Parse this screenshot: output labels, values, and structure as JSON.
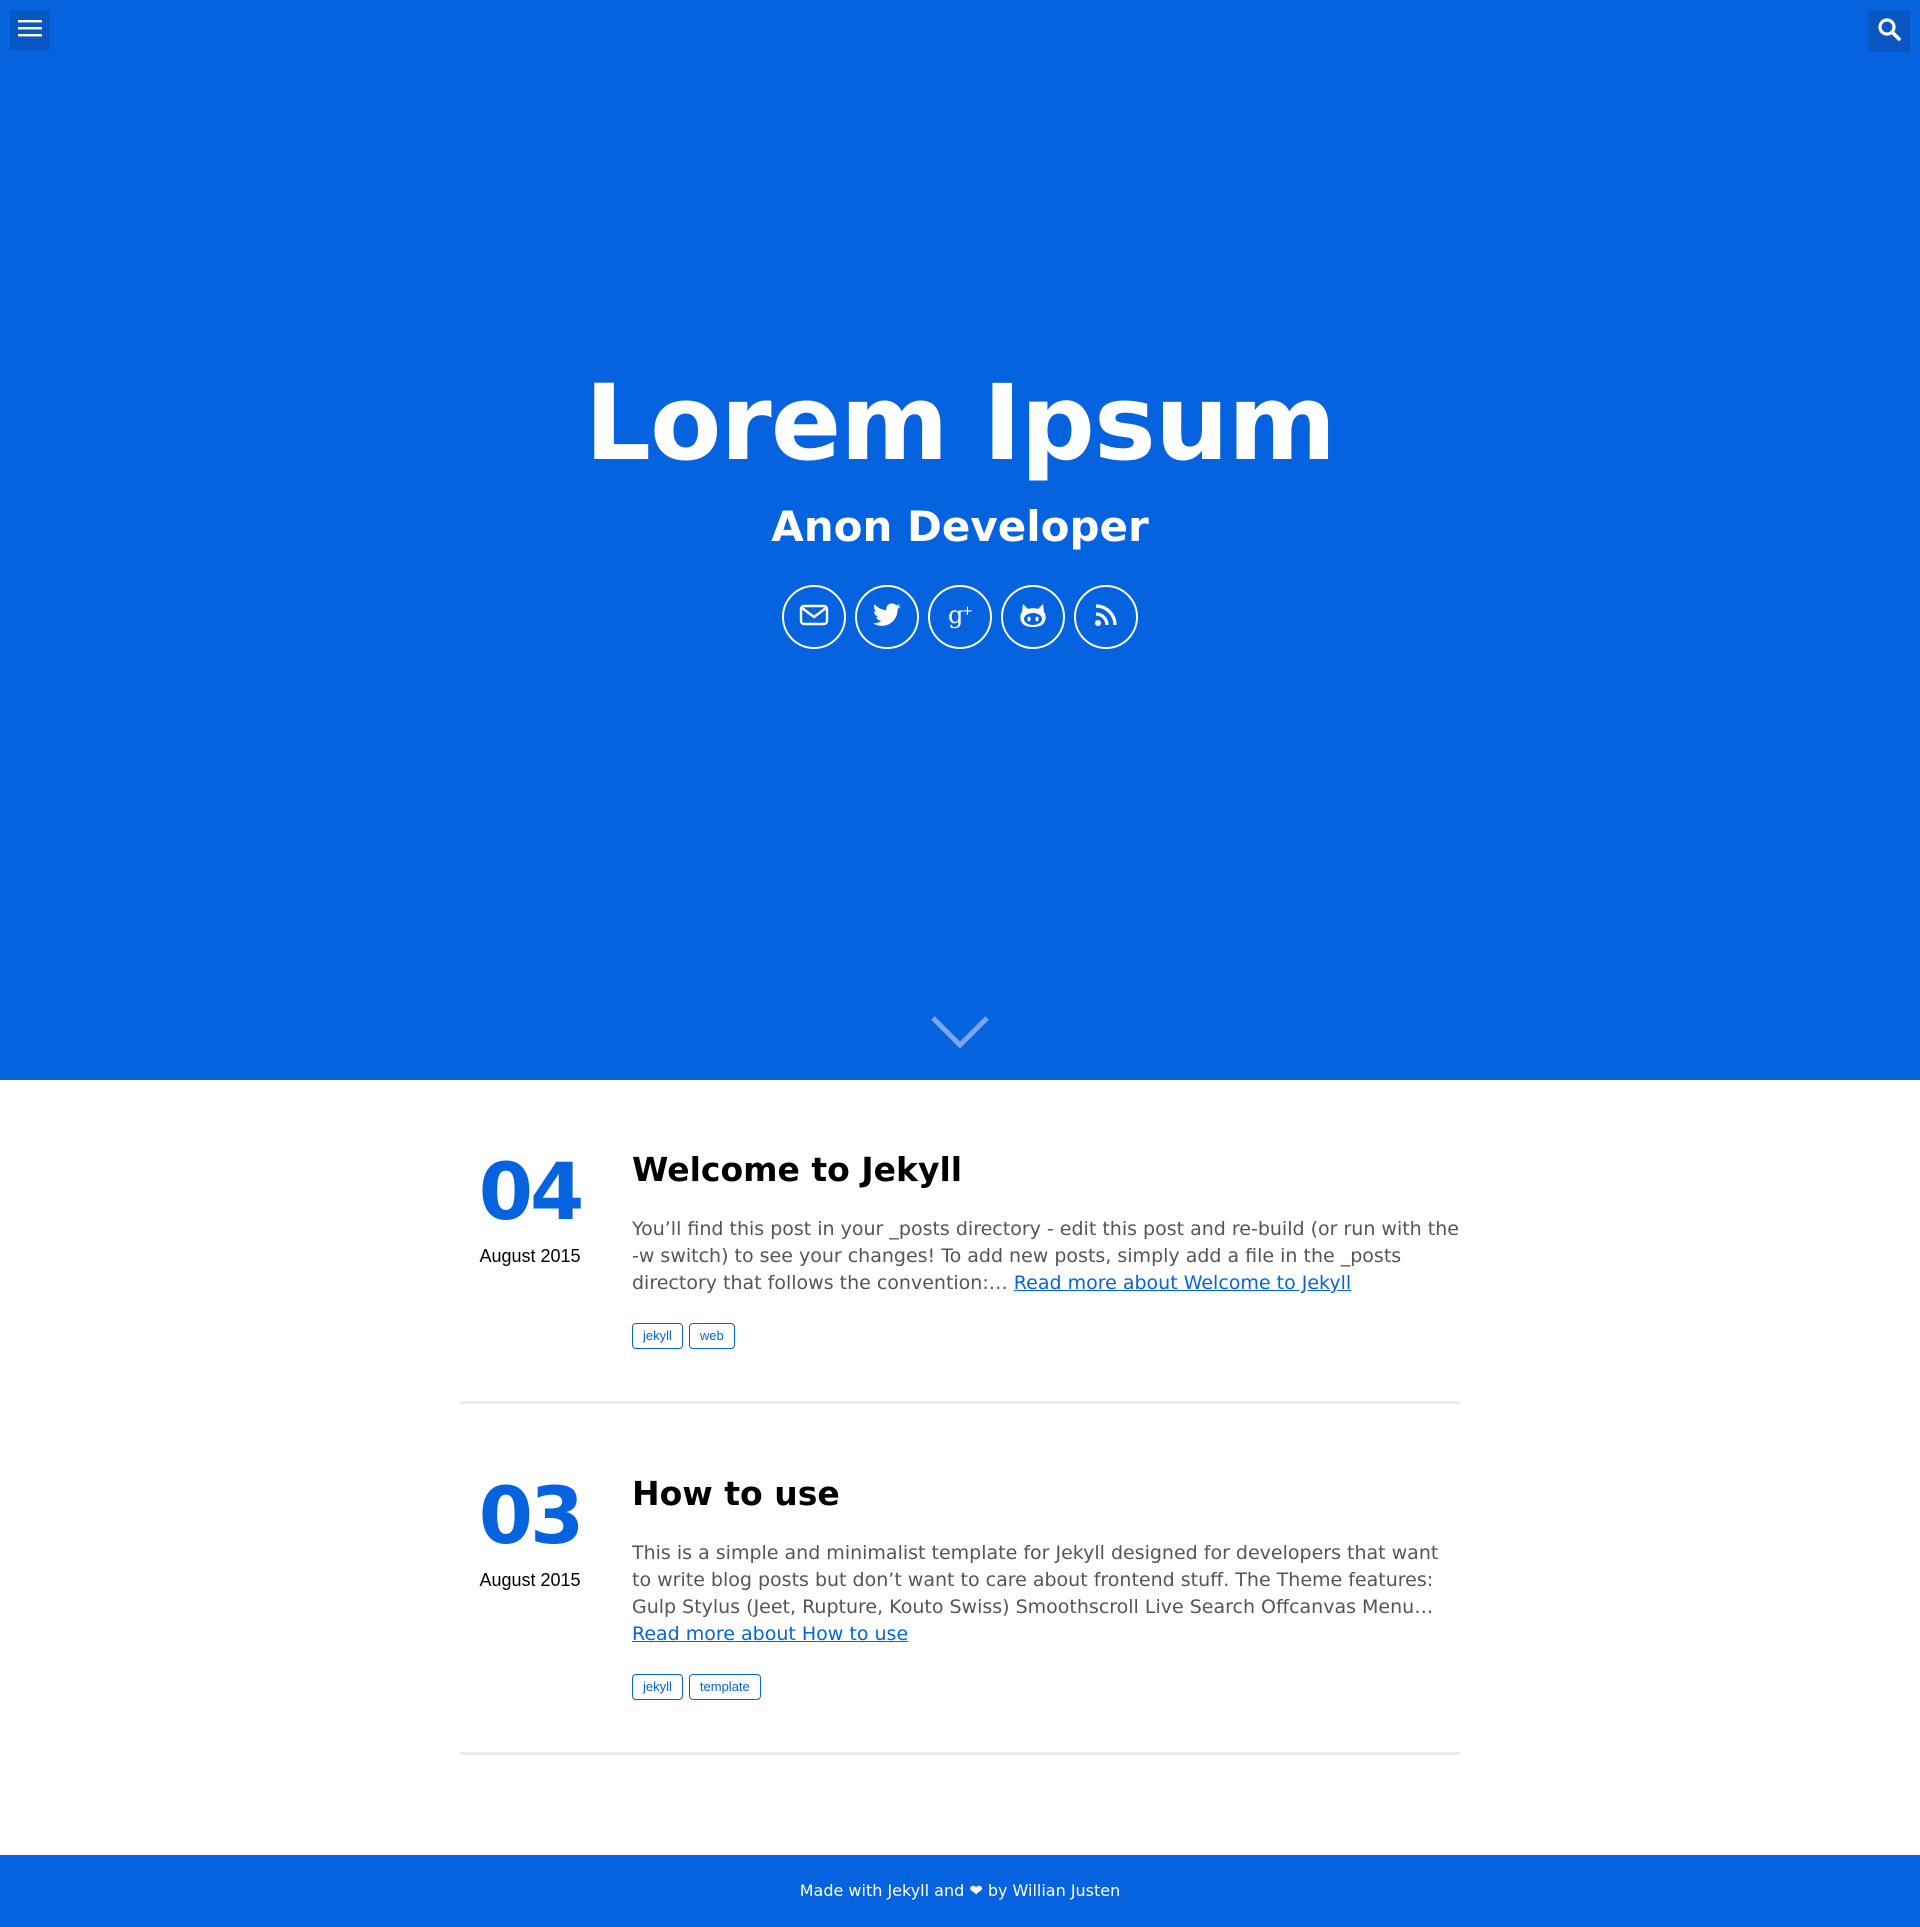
{
  "header": {
    "menu_icon": "hamburger-icon",
    "search_icon": "search-icon"
  },
  "hero": {
    "title": "Lorem Ipsum",
    "subtitle": "Anon Developer",
    "social": [
      {
        "icon": "envelope-icon"
      },
      {
        "icon": "twitter-icon"
      },
      {
        "icon": "google-plus-icon"
      },
      {
        "icon": "github-icon"
      },
      {
        "icon": "rss-icon"
      }
    ],
    "scroll_icon": "chevron-down-icon"
  },
  "posts": [
    {
      "day": "04",
      "month_year": "August 2015",
      "title": "Welcome to Jekyll",
      "excerpt": "You’ll find this post in your _posts directory - edit this post and re-build (or run with the -w switch) to see your changes! To add new posts, simply add a file in the _posts directory that follows the convention:…",
      "read_more": "Read more about Welcome to Jekyll",
      "tags": [
        "jekyll",
        "web"
      ]
    },
    {
      "day": "03",
      "month_year": "August 2015",
      "title": "How to use",
      "excerpt": "This is a simple and minimalist template for Jekyll designed for developers that want to write blog posts but don’t want to care about frontend stuff. The Theme features: Gulp Stylus (Jeet, Rupture, Kouto Swiss) Smoothscroll Live Search Offcanvas Menu…",
      "read_more": "Read more about How to use",
      "tags": [
        "jekyll",
        "template"
      ]
    }
  ],
  "footer": {
    "text": "Made with Jekyll and ❤ by Willian Justen"
  },
  "colors": {
    "primary": "#0663e0",
    "button_dark": "#0a56c2",
    "divider": "#ececec"
  }
}
